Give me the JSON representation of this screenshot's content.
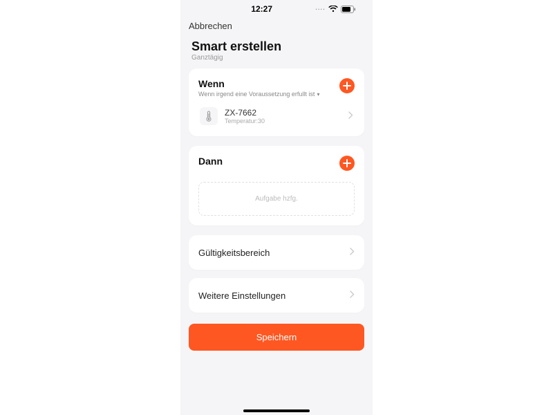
{
  "statusbar": {
    "time": "12:27"
  },
  "nav": {
    "cancel": "Abbrechen"
  },
  "page": {
    "title": "Smart erstellen",
    "subtitle": "Ganztägig"
  },
  "wenn": {
    "title": "Wenn",
    "subtitle": "Wenn irgend eine Voraussetzung erfullt ist",
    "device": {
      "name": "ZX-7662",
      "detail": "Temperatur:30"
    }
  },
  "dann": {
    "title": "Dann",
    "addTask": "Aufgabe hzfg."
  },
  "rows": {
    "validity": "Gültigkeitsbereich",
    "moreSettings": "Weitere Einstellungen"
  },
  "buttons": {
    "save": "Speichern"
  },
  "colors": {
    "accent": "#ff5722"
  }
}
